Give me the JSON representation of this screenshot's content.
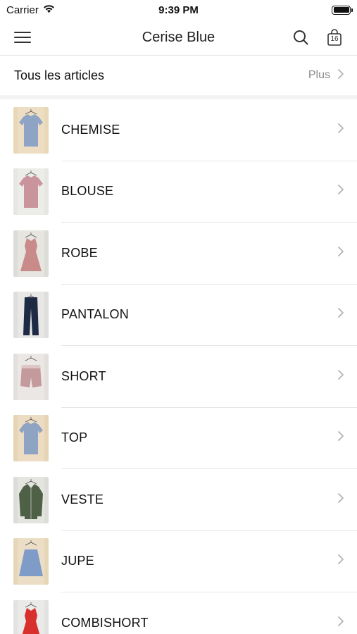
{
  "status_bar": {
    "carrier": "Carrier",
    "time": "9:39 PM",
    "wifi_icon": "wifi-icon",
    "battery_icon": "battery-icon"
  },
  "nav": {
    "title": "Cerise Blue",
    "menu_icon": "hamburger-menu-icon",
    "search_icon": "search-icon",
    "cart_icon": "shopping-bag-icon",
    "cart_count": "16"
  },
  "section": {
    "title": "Tous les articles",
    "more_label": "Plus"
  },
  "categories": [
    {
      "label": "CHEMISE",
      "thumb_bg": "#e9d7b8",
      "garment": "shirt",
      "garment_color": "#8fa4c4",
      "accent": "#f1e6d0"
    },
    {
      "label": "BLOUSE",
      "thumb_bg": "#e6e6e2",
      "garment": "shirt",
      "garment_color": "#c9949c",
      "accent": "#f5f3f1"
    },
    {
      "label": "ROBE",
      "thumb_bg": "#dcdcd8",
      "garment": "dress",
      "garment_color": "#c98a8a",
      "accent": "#f1efec"
    },
    {
      "label": "PANTALON",
      "thumb_bg": "#dededc",
      "garment": "pants",
      "garment_color": "#1d2a44",
      "accent": "#f3f2f0"
    },
    {
      "label": "SHORT",
      "thumb_bg": "#e3dfdc",
      "garment": "short",
      "garment_color": "#c49a9c",
      "accent": "#f4f1ef"
    },
    {
      "label": "TOP",
      "thumb_bg": "#e6d4b4",
      "garment": "shirt",
      "garment_color": "#8ea4c2",
      "accent": "#f2e7d4"
    },
    {
      "label": "VESTE",
      "thumb_bg": "#dcdcd8",
      "garment": "jacket",
      "garment_color": "#4e6046",
      "accent": "#f0efec"
    },
    {
      "label": "JUPE",
      "thumb_bg": "#e6d6b8",
      "garment": "skirt",
      "garment_color": "#7f9cc8",
      "accent": "#f3e8d6"
    },
    {
      "label": "COMBISHORT",
      "thumb_bg": "#e2e2e0",
      "garment": "dress",
      "garment_color": "#d8302c",
      "accent": "#f4f4f2"
    }
  ],
  "colors": {
    "divider": "#e6e6e6",
    "secondary_text": "#8a8a8a",
    "chevron": "#b3b3b3"
  }
}
